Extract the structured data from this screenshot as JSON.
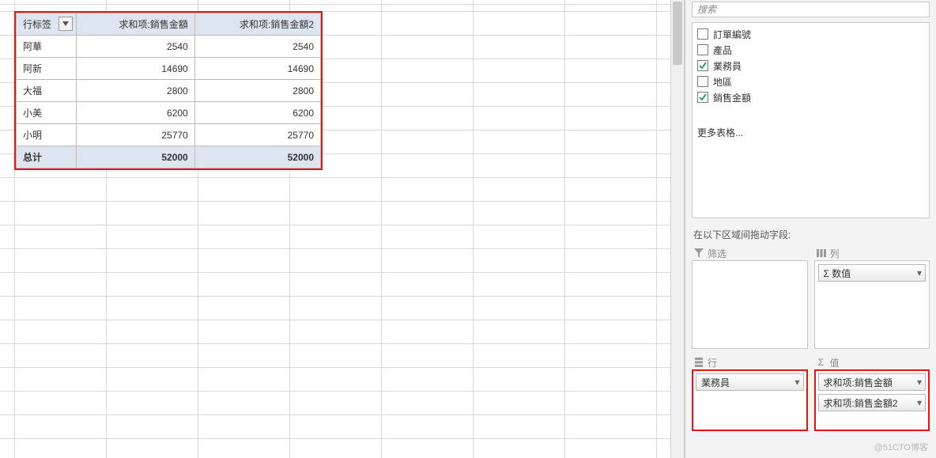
{
  "pivot": {
    "headers": {
      "row_label": "行标签",
      "col1": "求和项:銷售金額",
      "col2": "求和项:銷售金額2"
    },
    "rows": [
      {
        "label": "阿華",
        "v1": "2540",
        "v2": "2540"
      },
      {
        "label": "阿新",
        "v1": "14690",
        "v2": "14690"
      },
      {
        "label": "大福",
        "v1": "2800",
        "v2": "2800"
      },
      {
        "label": "小美",
        "v1": "6200",
        "v2": "6200"
      },
      {
        "label": "小明",
        "v1": "25770",
        "v2": "25770"
      }
    ],
    "total": {
      "label": "总计",
      "v1": "52000",
      "v2": "52000"
    }
  },
  "pane": {
    "search_placeholder": "搜索",
    "fields": [
      {
        "label": "訂單編號",
        "checked": false
      },
      {
        "label": "產品",
        "checked": false
      },
      {
        "label": "業務員",
        "checked": true
      },
      {
        "label": "地區",
        "checked": false
      },
      {
        "label": "銷售金額",
        "checked": true
      }
    ],
    "more_tables": "更多表格...",
    "between": "在以下区域间拖动字段:",
    "zones": {
      "filter": {
        "title": "筛选"
      },
      "columns": {
        "title": "列",
        "items": [
          "Σ 数值"
        ]
      },
      "rows": {
        "title": "行",
        "items": [
          "業務員"
        ]
      },
      "values": {
        "title": "值",
        "items": [
          "求和项:銷售金額",
          "求和项:銷售金額2"
        ]
      }
    }
  },
  "watermark": "@51CTO博客"
}
